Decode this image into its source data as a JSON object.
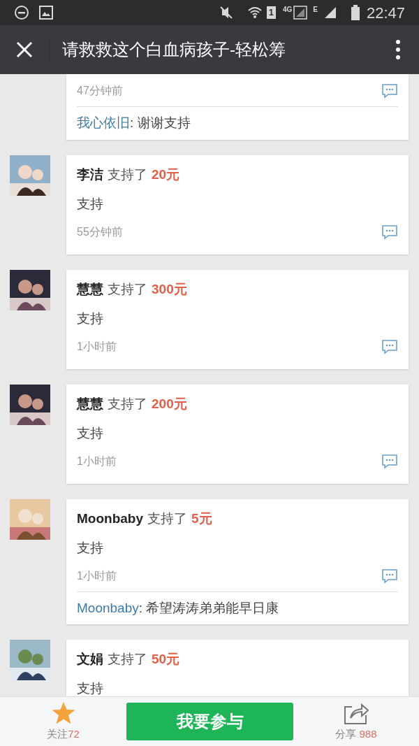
{
  "status_bar": {
    "time": "22:47",
    "network": "4G",
    "network_2": "E",
    "sim": "1"
  },
  "header": {
    "title": "请救救这个白血病孩子-轻松筹"
  },
  "comments": [
    {
      "time": "47分钟前",
      "replies": [
        {
          "name": "我心依旧",
          "text": ": 谢谢支持"
        }
      ]
    },
    {
      "name": "李洁",
      "action": "支持了",
      "amount": "20元",
      "message": "支持",
      "time": "55分钟前"
    },
    {
      "name": "慧慧",
      "action": "支持了",
      "amount": "300元",
      "message": "支持",
      "time": "1小时前"
    },
    {
      "name": "慧慧",
      "action": "支持了",
      "amount": "200元",
      "message": "支持",
      "time": "1小时前"
    },
    {
      "name": "Moonbaby",
      "action": "支持了",
      "amount": "5元",
      "message": "支持",
      "time": "1小时前",
      "replies": [
        {
          "name": "Moonbaby",
          "text": ": 希望涛涛弟弟能早日康"
        }
      ]
    },
    {
      "name": "文娟",
      "action": "支持了",
      "amount": "50元",
      "message": "支持"
    }
  ],
  "bottom_bar": {
    "follow": {
      "label": "关注",
      "count": "72"
    },
    "join_button": "我要参与",
    "share": {
      "label": "分享",
      "count": "988"
    }
  }
}
